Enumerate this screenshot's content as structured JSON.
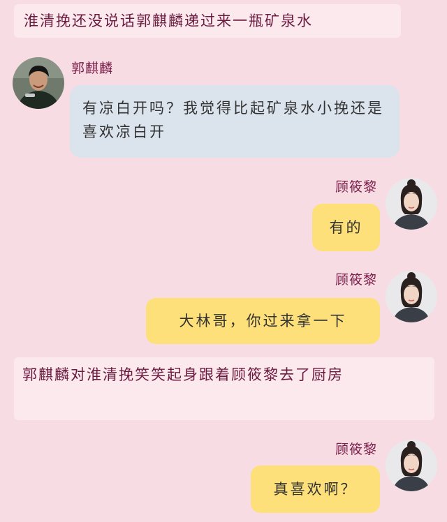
{
  "narrations": [
    "淮清挽还没说话郭麒麟递过来一瓶矿泉水",
    "郭麒麟对淮清挽笑笑起身跟着顾筱黎去了厨房"
  ],
  "messages": [
    {
      "speaker": "郭麒麟",
      "side": "left",
      "text": "有凉白开吗？我觉得比起矿泉水小挽还是喜欢凉白开"
    },
    {
      "speaker": "顾筱黎",
      "side": "right",
      "text": "有的"
    },
    {
      "speaker": "顾筱黎",
      "side": "right",
      "text": "大林哥，你过来拿一下"
    },
    {
      "speaker": "顾筱黎",
      "side": "right",
      "text": "真喜欢啊？"
    }
  ],
  "colors": {
    "background": "#f8dce3",
    "narration_bg": "#fbe9ee",
    "narration_text": "#6b1a3e",
    "speaker_name": "#7b1e4a",
    "left_bubble": "#dbe3ed",
    "right_bubble": "#fde07a"
  }
}
